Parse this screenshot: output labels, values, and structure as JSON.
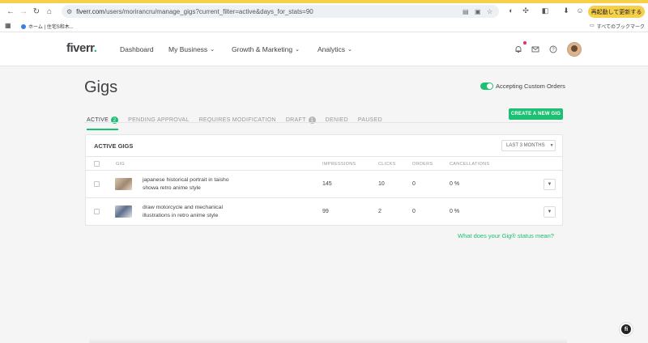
{
  "browser": {
    "url_host": "fiverr.com",
    "url_path": "/users/morirancru/manage_gigs?current_filter=active&days_for_stats=90",
    "relaunch_label": "再起動して更新する",
    "bookmarks": {
      "home_label": "ホーム | 住宅S和木...",
      "all_bookmarks_label": "すべてのブックマーク"
    }
  },
  "header": {
    "logo": "fiverr",
    "logo_dot": ".",
    "nav": [
      "Dashboard",
      "My Business",
      "Growth & Marketing",
      "Analytics"
    ]
  },
  "page": {
    "title": "Gigs",
    "toggle_label": "Accepting Custom Orders",
    "tabs": [
      {
        "label": "ACTIVE",
        "count": "2"
      },
      {
        "label": "PENDING APPROVAL",
        "count": null
      },
      {
        "label": "REQUIRES MODIFICATION",
        "count": null
      },
      {
        "label": "DRAFT",
        "count": "1"
      },
      {
        "label": "DENIED",
        "count": null
      },
      {
        "label": "PAUSED",
        "count": null
      }
    ],
    "create_button": "CREATE A NEW GIG"
  },
  "table": {
    "title": "ACTIVE GIGS",
    "period": "LAST 3 MONTHS",
    "columns": [
      "GIG",
      "IMPRESSIONS",
      "CLICKS",
      "ORDERS",
      "CANCELLATIONS"
    ],
    "rows": [
      {
        "title_line1": "japanese historical portrait in taisho",
        "title_line2": "showa retro anime style",
        "impressions": "145",
        "clicks": "10",
        "orders": "0",
        "cancellations": "0 %"
      },
      {
        "title_line1": "draw motorcycle and mechanical",
        "title_line2": "illustrations in retro anime style",
        "impressions": "99",
        "clicks": "2",
        "orders": "0",
        "cancellations": "0 %"
      }
    ]
  },
  "footer": {
    "status_link": "What does your Gig® status mean?"
  },
  "colors": {
    "brand_green": "#1dbf73",
    "chrome_yellow": "#f7d04a",
    "text_dark": "#404145",
    "notification_red": "#e0315b"
  }
}
